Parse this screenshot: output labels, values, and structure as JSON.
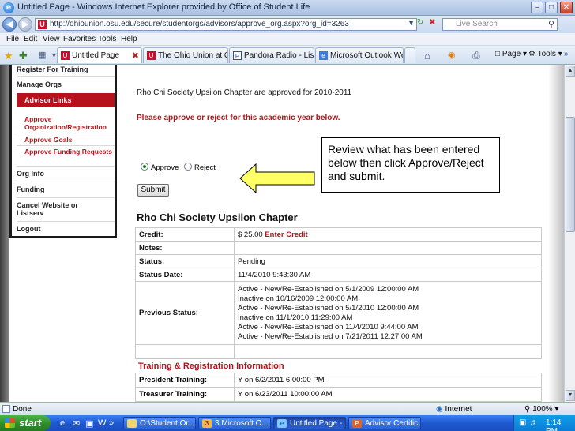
{
  "window": {
    "title": "Untitled Page - Windows Internet Explorer provided by Office of Student Life",
    "min_label": "–",
    "max_label": "□",
    "close_label": "✕"
  },
  "address_bar": {
    "url": "http://ohiounion.osu.edu/secure/studentorgs/advisors/approve_org.aspx?org_id=3263",
    "search_placeholder": "Live Search"
  },
  "menu": [
    "File",
    "Edit",
    "View",
    "Favorites",
    "Tools",
    "Help"
  ],
  "tabs": [
    {
      "label": "Untitled Page",
      "icon": "osu-icon",
      "active": true
    },
    {
      "label": "The Ohio Union at Ohio ...",
      "icon": "osu-icon",
      "active": false
    },
    {
      "label": "Pandora Radio - Listen ...",
      "icon": "pandora-icon",
      "active": false
    },
    {
      "label": "Microsoft Outlook Web ...",
      "icon": "ie-page-icon",
      "active": false
    }
  ],
  "command_bar": {
    "page_label": "Page",
    "tools_label": "Tools"
  },
  "sidebar": {
    "items": [
      {
        "label": "Register For Training",
        "type": "link"
      },
      {
        "label": "Manage Orgs",
        "type": "link"
      },
      {
        "label": "Advisor Links",
        "type": "highlight"
      },
      {
        "label": "Approve Organization/Registration",
        "type": "sub"
      },
      {
        "label": "Approve Goals",
        "type": "sub"
      },
      {
        "label": "Approve Funding Requests",
        "type": "sub"
      },
      {
        "label": "Org Info",
        "type": "link"
      },
      {
        "label": "Funding",
        "type": "link"
      },
      {
        "label": "Cancel Website or Listserv",
        "type": "link"
      },
      {
        "label": "Logout",
        "type": "link"
      }
    ]
  },
  "main": {
    "approved_text": "Rho Chi Society Upsilon Chapter are approved for 2010-2011",
    "please_text": "Please approve or reject for this academic year below.",
    "approve_label": "Approve",
    "reject_label": "Reject",
    "selected": "Approve",
    "submit_label": "Submit",
    "callout_text": "Review what has been entered below then click Approve/Reject and submit.",
    "org_title": "Rho Chi Society Upsilon Chapter",
    "info_rows": {
      "credit_label": "Credit:",
      "credit_value": "$ 25.00",
      "credit_link": "Enter Credit",
      "notes_label": "Notes:",
      "notes_value": "",
      "status_label": "Status:",
      "status_value": "Pending",
      "status_date_label": "Status Date:",
      "status_date_value": "11/4/2010 9:43:30 AM",
      "previous_label": "Previous Status:",
      "previous_values": [
        "Active - New/Re-Established   on 5/1/2009 12:00:00 AM",
        "Inactive   on 10/16/2009 12:00:00 AM",
        "Active - New/Re-Established on 5/1/2010 12:00:00 AM",
        "Inactive on 11/1/2010 11:29:00 AM",
        "Active - New/Re-Established on 11/4/2010 9:44:00 AM",
        "Active - New/Re-Established on 7/21/2011 12:27:00 AM"
      ]
    },
    "training_header": "Training & Registration Information",
    "training_rows": [
      {
        "label": "President Training:",
        "value": "Y on 6/2/2011 6:00:00 PM"
      },
      {
        "label": "Treasurer Training:",
        "value": "Y on 6/23/2011 10:00:00 AM"
      }
    ]
  },
  "status_bar": {
    "status": "Done",
    "zone": "Internet",
    "zoom": "100%"
  },
  "taskbar": {
    "start_label": "start",
    "tasks": [
      {
        "label": "O:\\Student Or...",
        "active": false
      },
      {
        "label": "3 Microsoft O...",
        "active": false
      },
      {
        "label": "Untitled Page - ...",
        "active": true
      },
      {
        "label": "Advisor Certific...",
        "active": false
      }
    ],
    "clock": "1:14 PM"
  },
  "colors": {
    "accent_red": "#b5121b",
    "arrow_fill": "#ffff66",
    "taskbar_blue": "#2b63d9",
    "start_green": "#2f8d2a"
  }
}
